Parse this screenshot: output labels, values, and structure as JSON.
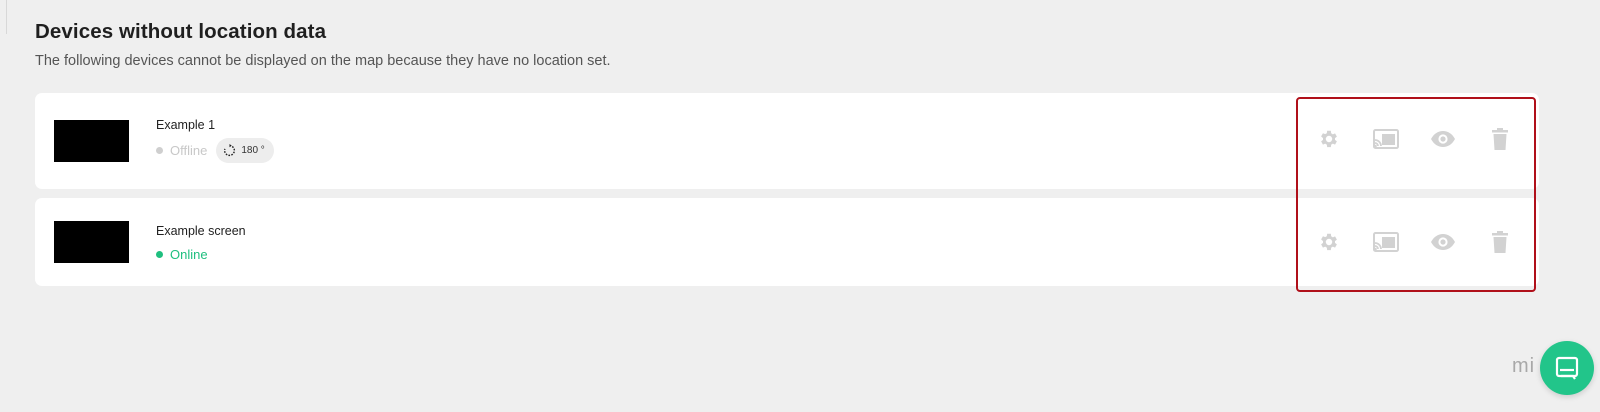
{
  "section": {
    "title": "Devices without location data",
    "subtitle": "The following devices cannot be displayed on the map because they have no location set."
  },
  "devices": [
    {
      "name": "Example 1",
      "status": "Offline",
      "rotation": "180 °",
      "actions": [
        "gear-icon",
        "cast-icon",
        "eye-icon",
        "trash-icon"
      ]
    },
    {
      "name": "Example screen",
      "status": "Online",
      "actions": [
        "gear-icon",
        "cast-icon",
        "eye-icon",
        "trash-icon"
      ]
    }
  ],
  "brand": {
    "partial_text": "mi"
  },
  "colors": {
    "background": "#efefef",
    "card": "#ffffff",
    "online": "#1fbf7f",
    "offline": "#cfcfcf",
    "icon": "#d2d2d2",
    "highlight": "#b0101a",
    "chat": "#22c58a"
  }
}
